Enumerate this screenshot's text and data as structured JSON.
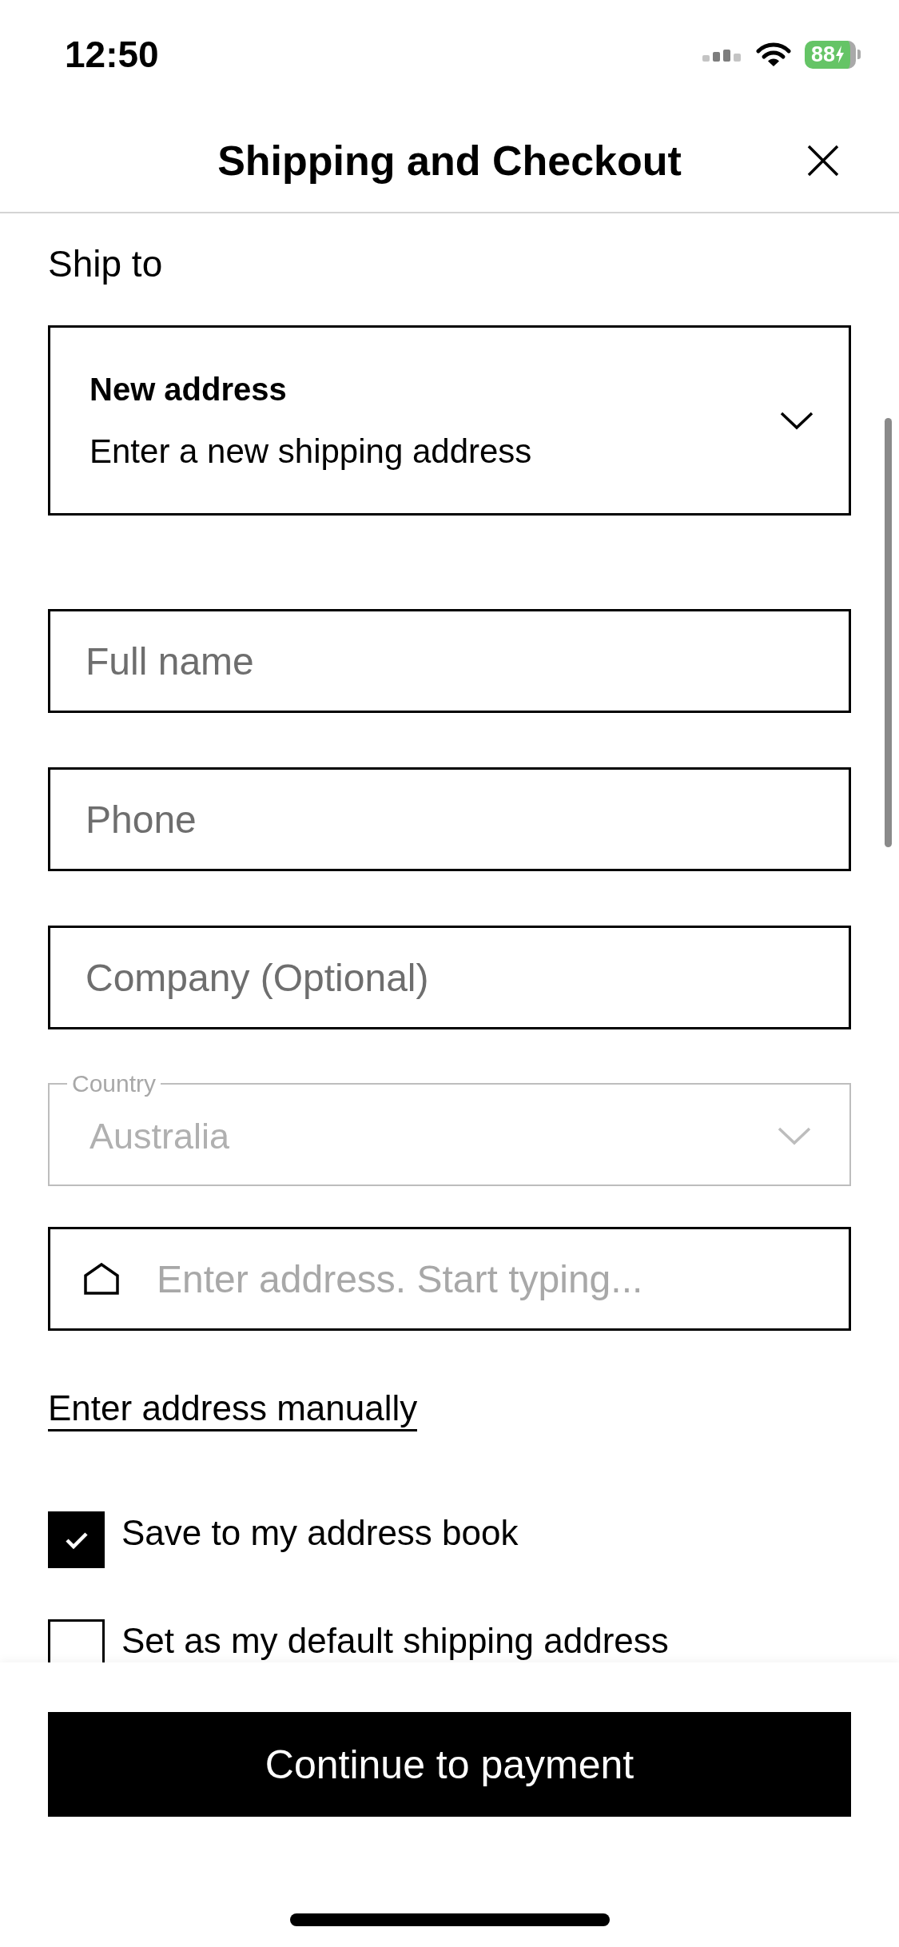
{
  "status_bar": {
    "time": "12:50",
    "battery": "88",
    "charging": true
  },
  "header": {
    "title": "Shipping and Checkout"
  },
  "ship_to": {
    "label": "Ship to",
    "address": {
      "title": "New address",
      "subtitle": "Enter a new shipping address"
    }
  },
  "fields": [
    {
      "kind": "text",
      "placeholder": "Full name"
    },
    {
      "kind": "text",
      "placeholder": "Phone"
    },
    {
      "kind": "text",
      "placeholder": "Company (Optional)"
    },
    {
      "kind": "select",
      "label": "Country",
      "value": "Australia",
      "disabled": true
    },
    {
      "kind": "search",
      "placeholder": "Enter address. Start typing..."
    }
  ],
  "manual_entry_link": "Enter address manually",
  "checkboxes": [
    {
      "label": "Save to my address book",
      "checked": true
    },
    {
      "label": "Set as my default shipping address",
      "checked": false
    }
  ],
  "footer": {
    "button": "Continue to payment"
  }
}
